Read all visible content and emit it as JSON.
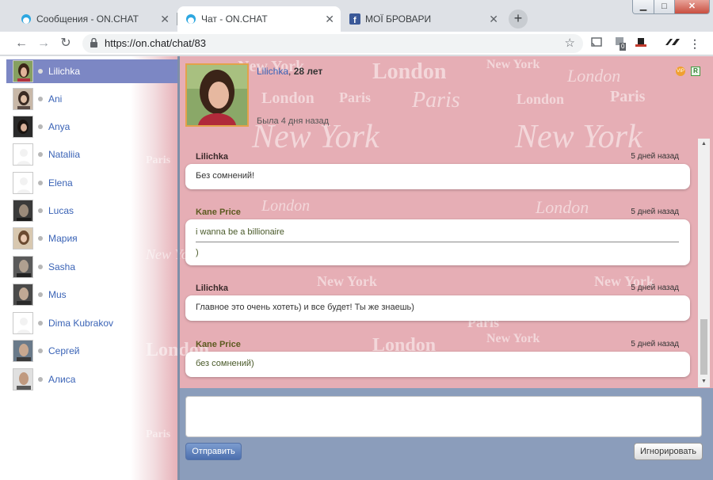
{
  "browser": {
    "tabs": [
      {
        "title": "Сообщения - ON.CHAT",
        "active": false
      },
      {
        "title": "Чат - ON.CHAT",
        "active": true
      },
      {
        "title": "МОЇ БРОВАРИ",
        "active": false
      }
    ],
    "new_tab_label": "+",
    "url": "https://on.chat/chat/83",
    "extensions": [
      "cast-icon",
      "extension-badge-icon",
      "hat-extension-icon",
      "logo-extension-icon",
      "menu-icon"
    ],
    "extension_badge": "0"
  },
  "background_words": [
    "New York",
    "London",
    "Paris"
  ],
  "sidebar": {
    "contacts": [
      {
        "name": "Lilichka",
        "selected": true,
        "avatar": "photo"
      },
      {
        "name": "Ani",
        "selected": false,
        "avatar": "photo"
      },
      {
        "name": "Anya",
        "selected": false,
        "avatar": "photo"
      },
      {
        "name": "Nataliia",
        "selected": false,
        "avatar": "placeholder"
      },
      {
        "name": "Elena",
        "selected": false,
        "avatar": "placeholder"
      },
      {
        "name": "Lucas",
        "selected": false,
        "avatar": "photo"
      },
      {
        "name": "Мария",
        "selected": false,
        "avatar": "photo"
      },
      {
        "name": "Sasha",
        "selected": false,
        "avatar": "photo"
      },
      {
        "name": "Mus",
        "selected": false,
        "avatar": "photo"
      },
      {
        "name": "Dima Kubrakov",
        "selected": false,
        "avatar": "placeholder"
      },
      {
        "name": "Сергей",
        "selected": false,
        "avatar": "photo"
      },
      {
        "name": "Алиса",
        "selected": false,
        "avatar": "photo"
      }
    ]
  },
  "chat": {
    "partner_name": "Lilichka",
    "partner_age_sep": ", ",
    "partner_age": "28 лет",
    "last_seen": "Была 4 дня назад",
    "vip_label": "VIP",
    "r_label": "R",
    "messages": [
      {
        "author": "Lilichka",
        "time": "5 дней назад",
        "mine": false,
        "lines": [
          "Без сомнений!"
        ]
      },
      {
        "author": "Kane Price",
        "time": "5 дней назад",
        "mine": true,
        "lines": [
          "i wanna be a billionaire",
          ")"
        ]
      },
      {
        "author": "Lilichka",
        "time": "5 дней назад",
        "mine": false,
        "lines": [
          "Главное это очень хотеть) и все будет! Ты же знаешь)"
        ]
      },
      {
        "author": "Kane Price",
        "time": "5 дней назад",
        "mine": true,
        "lines": [
          "без сомнений)"
        ]
      }
    ]
  },
  "compose": {
    "text_value": "",
    "send_label": "Отправить",
    "ignore_label": "Игнорировать"
  },
  "colors": {
    "background_pink": "#e6aeb5",
    "selected_contact": "#7c87c4",
    "compose_panel": "#8b9dbb",
    "link_blue": "#3a63b6"
  }
}
